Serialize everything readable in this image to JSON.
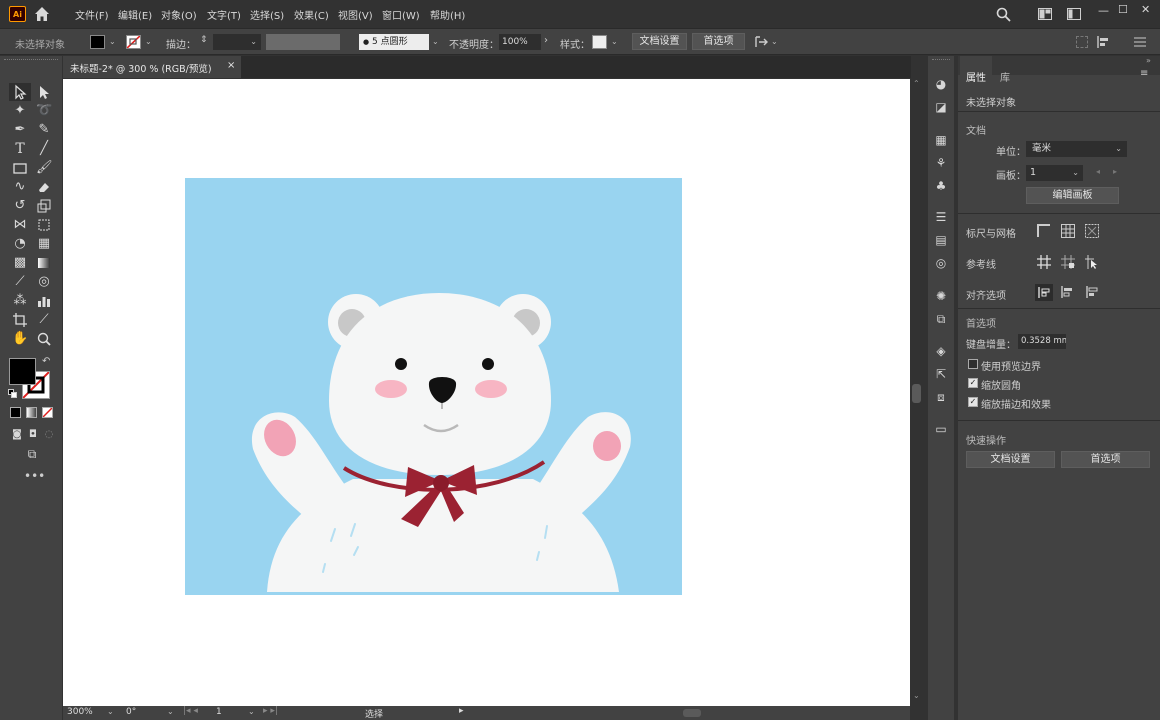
{
  "app": {
    "logo": "Ai"
  },
  "menu": [
    "文件(F)",
    "编辑(E)",
    "对象(O)",
    "文字(T)",
    "选择(S)",
    "效果(C)",
    "视图(V)",
    "窗口(W)",
    "帮助(H)"
  ],
  "window_controls": {
    "minimize": "—",
    "maximize": "☐",
    "close": "✕"
  },
  "controlbar": {
    "selection_label": "未选择对象",
    "stroke_label": "描边：",
    "brush_value": "5 点圆形",
    "opacity_label": "不透明度：",
    "opacity_value": "100%",
    "style_label": "样式：",
    "doc_settings_button": "文档设置",
    "prefs_button": "首选项"
  },
  "document_tab": {
    "title": "未标题-2* @ 300 % (RGB/预览)",
    "close": "×"
  },
  "statusbar": {
    "zoom": "300%",
    "rotation": "0°",
    "artboard": "1",
    "tool": "选择"
  },
  "panel": {
    "tabs": [
      "属性",
      "库"
    ],
    "selection": "未选择对象",
    "document_section": "文档",
    "units_label": "单位：",
    "units_value": "毫米",
    "artboard_label": "画板：",
    "artboard_value": "1",
    "edit_artboard_button": "编辑画板",
    "rulers_label": "标尺与网格",
    "guides_label": "参考线",
    "align_label": "对齐选项",
    "prefs_section": "首选项",
    "keyboard_increment_label": "键盘增量：",
    "keyboard_increment_value": "0.3528 mm",
    "checkboxes": [
      {
        "label": "使用预览边界",
        "checked": false
      },
      {
        "label": "缩放圆角",
        "checked": true
      },
      {
        "label": "缩放描边和效果",
        "checked": true
      }
    ],
    "quick_actions_label": "快速操作",
    "doc_settings_button": "文档设置",
    "prefs_button": "首选项"
  },
  "colors": {
    "artboard_bg": "#99d4f0",
    "bear_white": "#f5f6f6",
    "ear_inner": "#c8c8c8",
    "blush": "#f7b5c3",
    "paw": "#f2a3b6",
    "bow": "#9b2232",
    "ui_dark": "#323232",
    "ui_panel": "#424242"
  }
}
